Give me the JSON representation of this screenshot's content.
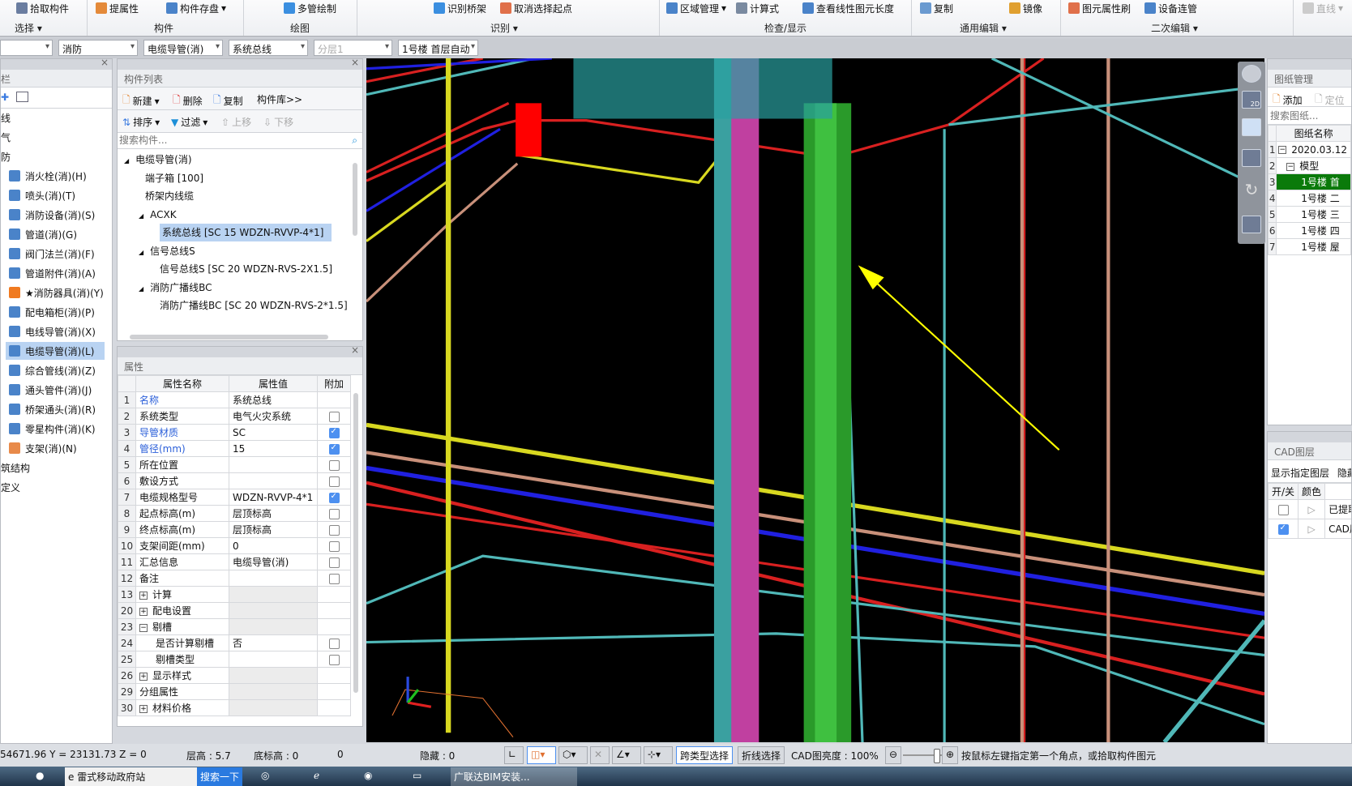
{
  "ribbon": {
    "buttons": [
      "拾取构件",
      "提属性",
      "构件存盘",
      "多管绘制",
      "识别桥架",
      "取消选择起点",
      "区域管理",
      "计算式",
      "查看线性图元长度",
      "复制",
      "镜像",
      "图元属性刷",
      "设备连管",
      "直线"
    ],
    "groups": [
      "选择",
      "构件",
      "绘图",
      "识别",
      "检查/显示",
      "通用编辑",
      "二次编辑"
    ]
  },
  "combos": [
    "",
    "消防",
    "电缆导管(消)",
    "系统总线",
    "分层1",
    "1号楼 首层自动"
  ],
  "nav": {
    "items": [
      "线",
      "气",
      "防",
      "消火栓(消)(H)",
      "喷头(消)(T)",
      "消防设备(消)(S)",
      "管道(消)(G)",
      "阀门法兰(消)(F)",
      "管道附件(消)(A)",
      "★消防器具(消)(Y)",
      "配电箱柜(消)(P)",
      "电线导管(消)(X)",
      "电缆导管(消)(L)",
      "综合管线(消)(Z)",
      "通头管件(消)(J)",
      "桥架通头(消)(R)",
      "零星构件(消)(K)",
      "支架(消)(N)",
      "筑结构",
      "定义"
    ],
    "title": "栏",
    "selected": "电缆导管(消)(L)"
  },
  "component_list": {
    "title": "构件列表",
    "toolbar": [
      "新建",
      "删除",
      "复制",
      "构件库>>"
    ],
    "toolbar2": [
      "排序",
      "过滤",
      "上移",
      "下移"
    ],
    "search_placeholder": "搜索构件...",
    "tree": [
      "电缆导管(消)",
      "端子箱 [100]",
      "桥架内线缆",
      "ACXK",
      "系统总线 [SC 15 WDZN-RVVP-4*1]",
      "信号总线S",
      "信号总线S [SC 20 WDZN-RVS-2X1.5]",
      "消防广播线BC",
      "消防广播线BC [SC 20 WDZN-RVS-2*1.5]"
    ],
    "selected": "系统总线 [SC 15 WDZN-RVVP-4*1]"
  },
  "properties": {
    "title": "属性",
    "headers": [
      "属性名称",
      "属性值",
      "附加"
    ],
    "rows": [
      {
        "n": "1",
        "name": "名称",
        "value": "系统总线",
        "blue": true,
        "check": null
      },
      {
        "n": "2",
        "name": "系统类型",
        "value": "电气火灾系统",
        "check": false
      },
      {
        "n": "3",
        "name": "导管材质",
        "value": "SC",
        "blue": true,
        "check": true
      },
      {
        "n": "4",
        "name": "管径(mm)",
        "value": "15",
        "blue": true,
        "check": true
      },
      {
        "n": "5",
        "name": "所在位置",
        "value": "",
        "check": false
      },
      {
        "n": "6",
        "name": "敷设方式",
        "value": "",
        "check": false
      },
      {
        "n": "7",
        "name": "电缆规格型号",
        "value": "WDZN-RVVP-4*1",
        "check": true
      },
      {
        "n": "8",
        "name": "起点标高(m)",
        "value": "层顶标高",
        "check": false
      },
      {
        "n": "9",
        "name": "终点标高(m)",
        "value": "层顶标高",
        "check": false
      },
      {
        "n": "10",
        "name": "支架间距(mm)",
        "value": "0",
        "check": false
      },
      {
        "n": "11",
        "name": "汇总信息",
        "value": "电缆导管(消)",
        "check": false
      },
      {
        "n": "12",
        "name": "备注",
        "value": "",
        "check": false
      },
      {
        "n": "13",
        "name": "计算",
        "group": "+",
        "check": null
      },
      {
        "n": "20",
        "name": "配电设置",
        "group": "+",
        "check": null
      },
      {
        "n": "23",
        "name": "剔槽",
        "group": "-",
        "check": null
      },
      {
        "n": "24",
        "name": "是否计算剔槽",
        "value": "否",
        "child": true,
        "check": false
      },
      {
        "n": "25",
        "name": "剔槽类型",
        "value": "",
        "child": true,
        "check": false
      },
      {
        "n": "26",
        "name": "显示样式",
        "group": "+",
        "check": null
      },
      {
        "n": "29",
        "name": "分组属性",
        "group": "",
        "check": null
      },
      {
        "n": "30",
        "name": "材料价格",
        "group": "+",
        "check": null
      }
    ]
  },
  "drawings": {
    "title": "图纸管理",
    "toolbar": [
      "添加",
      "定位"
    ],
    "search_placeholder": "搜索图纸...",
    "header": "图纸名称",
    "rows": [
      {
        "n": "1",
        "label": "2020.03.12"
      },
      {
        "n": "2",
        "label": "模型"
      },
      {
        "n": "3",
        "label": "1号楼 首"
      },
      {
        "n": "4",
        "label": "1号楼 二"
      },
      {
        "n": "5",
        "label": "1号楼 三"
      },
      {
        "n": "6",
        "label": "1号楼 四"
      },
      {
        "n": "7",
        "label": "1号楼 屋"
      }
    ],
    "selected_row": "3"
  },
  "cad_layers": {
    "title": "CAD图层",
    "toolbar": [
      "显示指定图层",
      "隐藏"
    ],
    "headers": [
      "开/关",
      "颜色"
    ],
    "rows": [
      {
        "on": false,
        "label": "已提取"
      },
      {
        "on": true,
        "label": "CAD原"
      }
    ]
  },
  "viewcube": {
    "label_2d": "2D"
  },
  "status": {
    "coords": "54671.96 Y = 23131.73 Z = 0",
    "floor_height": "层高 : 5.7",
    "base_height": "底标高 : 0",
    "zero": "0",
    "hidden": "隐藏 : 0",
    "cross_select": "跨类型选择",
    "polyline_select": "折线选择",
    "cad_brightness": "CAD图亮度 : 100%",
    "cad_brightness_value": 100,
    "hint": "按鼠标左键指定第一个角点，或拾取构件图元"
  },
  "taskbar": {
    "items": [
      "",
      "雷式移动政府站",
      "搜索一下",
      "",
      "",
      "",
      "",
      "广联达BIM安装..."
    ]
  },
  "colors": {
    "selection": "#b9d3f2",
    "viewport_bg": "#000000",
    "tree_selected": "#0a7a0a",
    "accent": "#4d90f0"
  }
}
